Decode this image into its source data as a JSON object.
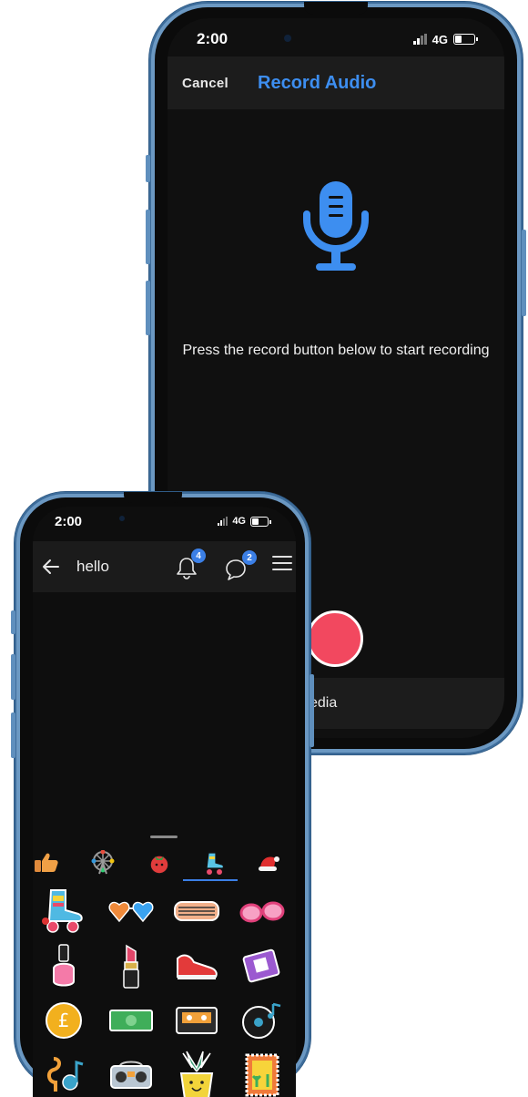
{
  "back_phone": {
    "status": {
      "time": "2:00",
      "network": "4G"
    },
    "header": {
      "cancel_label": "Cancel",
      "title": "Record Audio"
    },
    "hint": "Press the record button below to start recording",
    "media_partial_label": "edia",
    "colors": {
      "accent": "#3d8ef0",
      "record": "#f2485f",
      "header_bg": "#1c1c1c"
    }
  },
  "front_phone": {
    "status": {
      "time": "2:00",
      "network": "4G"
    },
    "header": {
      "chat_title": "hello",
      "notification_count": "4",
      "message_count": "2"
    },
    "sticker_tabs": [
      {
        "icon": "thumbs-up"
      },
      {
        "icon": "ferris-wheel"
      },
      {
        "icon": "tomato"
      },
      {
        "icon": "roller-skate",
        "selected": true
      },
      {
        "icon": "santa-hat"
      }
    ],
    "stickers": [
      [
        "roller-skate",
        "heart-sunglasses",
        "shutter-shades",
        "pink-glasses"
      ],
      [
        "nail-polish",
        "lipstick",
        "red-sneaker",
        "cassette-purple"
      ],
      [
        "pound-coin",
        "banknote",
        "cassette-tape",
        "vinyl-record"
      ],
      [
        "music-notes",
        "boombox",
        "potted-plant",
        "stamp"
      ]
    ],
    "colors": {
      "accent": "#3b7fe6"
    }
  }
}
